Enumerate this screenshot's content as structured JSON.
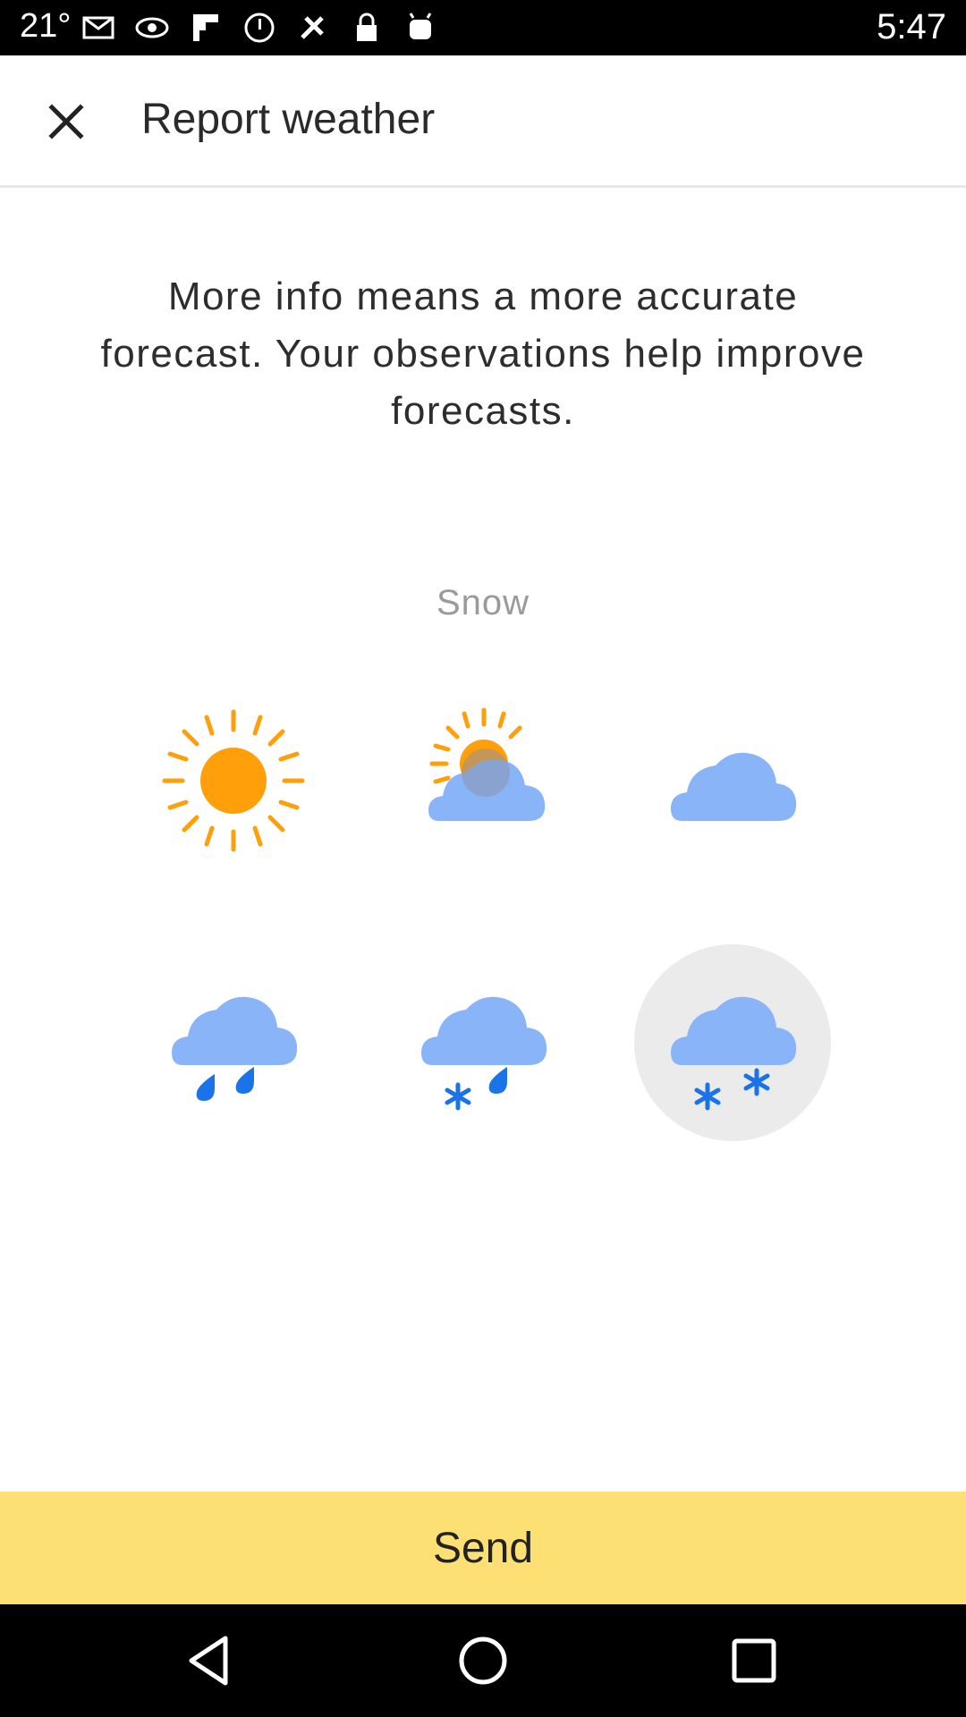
{
  "status_bar": {
    "temperature": "21°",
    "time": "5:47",
    "icons": [
      "gmail-icon",
      "vision-icon",
      "flipboard-icon",
      "dnd-icon",
      "fake-gps-icon",
      "lock-icon",
      "android-icon"
    ]
  },
  "app_bar": {
    "title": "Report weather",
    "close_icon": "close-icon"
  },
  "intro_text": "More info means a more accurate forecast. Your observations help improve forecasts.",
  "selected_condition_label": "Snow",
  "conditions": [
    {
      "icon": "sunny-icon",
      "selected": false
    },
    {
      "icon": "partly-cloudy-icon",
      "selected": false
    },
    {
      "icon": "cloudy-icon",
      "selected": false
    },
    {
      "icon": "rain-icon",
      "selected": false
    },
    {
      "icon": "sleet-icon",
      "selected": false
    },
    {
      "icon": "snow-icon",
      "selected": true
    }
  ],
  "send_button": {
    "label": "Send"
  },
  "colors": {
    "sun": "#ff9f0a",
    "cloud": "#8ab4f8",
    "drop": "#1a73e8",
    "send_bar": "#fde074",
    "selected_bg": "#ebebeb"
  },
  "nav_bar": {
    "buttons": [
      "back-icon",
      "home-icon",
      "recents-icon"
    ]
  }
}
